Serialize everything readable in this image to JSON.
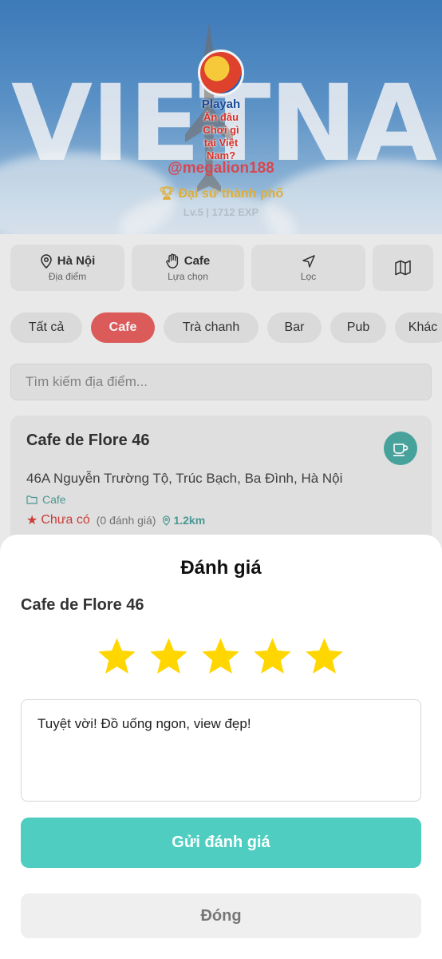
{
  "hero": {
    "background_word": "VIETNAM",
    "logo": {
      "brand": "Playah",
      "slogan_line1": "Ăn đâu Chơi gì",
      "slogan_line2": "tại Việt Nam?"
    },
    "username": "@megalion188",
    "title": "Đại sứ thành phố",
    "level_text": "Lv.5 | 1712 EXP"
  },
  "filters": [
    {
      "label": "Hà Nội",
      "sub": "Địa điểm",
      "icon": "map-pin-icon"
    },
    {
      "label": "Cafe",
      "sub": "Lựa chọn",
      "icon": "hand-icon"
    },
    {
      "label": "",
      "sub": "Lọc",
      "icon": "navigation-icon"
    },
    {
      "label": "",
      "sub": "",
      "icon": "map-icon"
    }
  ],
  "chips": [
    "Tất cả",
    "Cafe",
    "Trà chanh",
    "Bar",
    "Pub",
    "Khác"
  ],
  "active_chip": "Cafe",
  "search": {
    "placeholder": "Tìm kiếm địa điểm..."
  },
  "place_card": {
    "name": "Cafe de Flore 46",
    "address": "46A Nguyễn Trường Tộ, Trúc Bạch, Ba Đình, Hà Nội",
    "category": "Cafe",
    "rating_text": "Chưa có",
    "review_count": "(0 đánh giá)",
    "distance": "1.2km"
  },
  "review_sheet": {
    "title": "Đánh giá",
    "place_name": "Cafe de Flore 46",
    "stars_total": 5,
    "stars_selected": 5,
    "review_text": "Tuyệt vời! Đồ uống ngon, view đẹp!",
    "submit_label": "Gửi đánh giá",
    "close_label": "Đóng"
  },
  "colors": {
    "accent": "#4ecdc0",
    "active_chip": "#e45f5f",
    "star": "#ffd600",
    "username": "#e04a55",
    "title": "#e8b63a"
  }
}
